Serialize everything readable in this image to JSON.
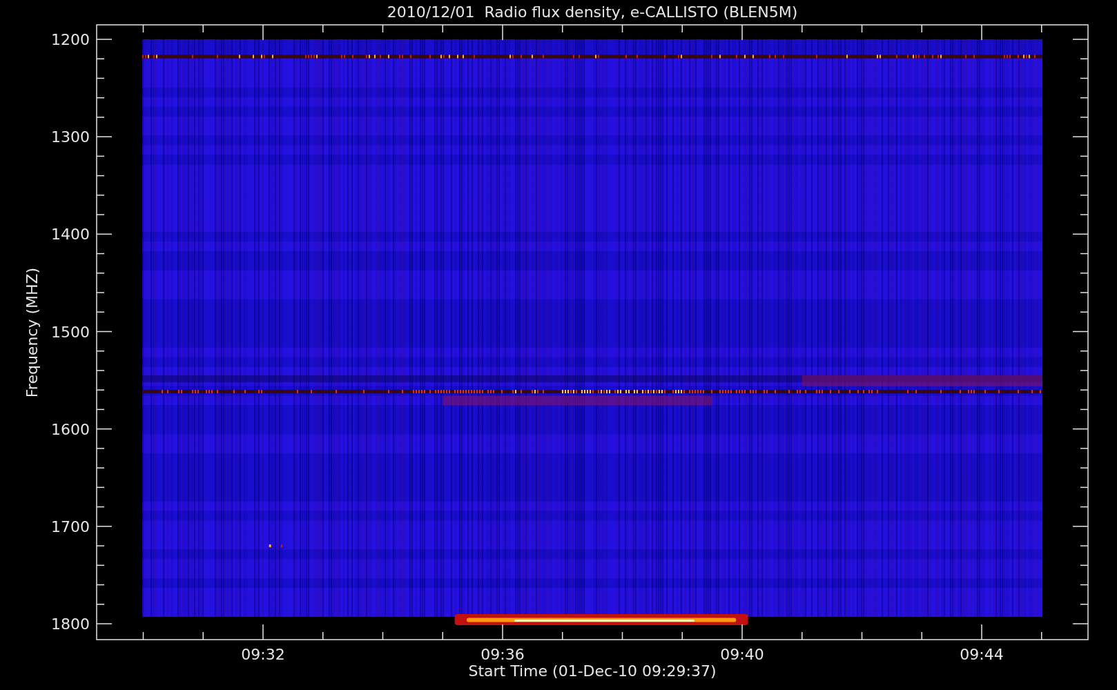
{
  "plot": {
    "title": "2010/12/01  Radio flux density, e-CALLISTO (BLEN5M)",
    "xlabel": "Start Time (01-Dec-10 09:29:37)",
    "ylabel": "Frequency (MHZ)",
    "yticks": [
      "1200",
      "1300",
      "1400",
      "1500",
      "1600",
      "1700",
      "1800"
    ],
    "xticks": [
      "09:32",
      "09:36",
      "09:40",
      "09:44"
    ]
  }
}
